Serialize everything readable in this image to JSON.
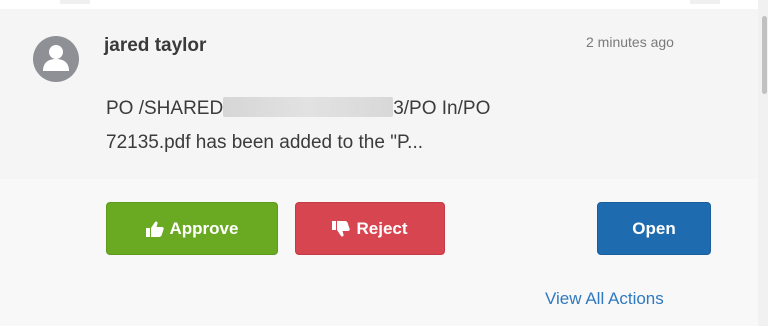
{
  "notification": {
    "user_name": "jared taylor",
    "timestamp": "2 minutes ago",
    "message_line1_start": "PO /SHARED",
    "message_line1_end": "3/PO In/PO",
    "message_line2": "72135.pdf has been added to the \"P..."
  },
  "actions": {
    "approve_label": "Approve",
    "reject_label": "Reject",
    "open_label": "Open",
    "view_all_label": "View All Actions"
  },
  "icons": {
    "avatar": "user-avatar-icon",
    "approve": "thumbs-up-icon",
    "reject": "thumbs-down-icon"
  },
  "colors": {
    "approve": "#6aa922",
    "reject": "#d64550",
    "open": "#1e6bb0",
    "link": "#2f79c0",
    "avatar": "#8f9095"
  }
}
